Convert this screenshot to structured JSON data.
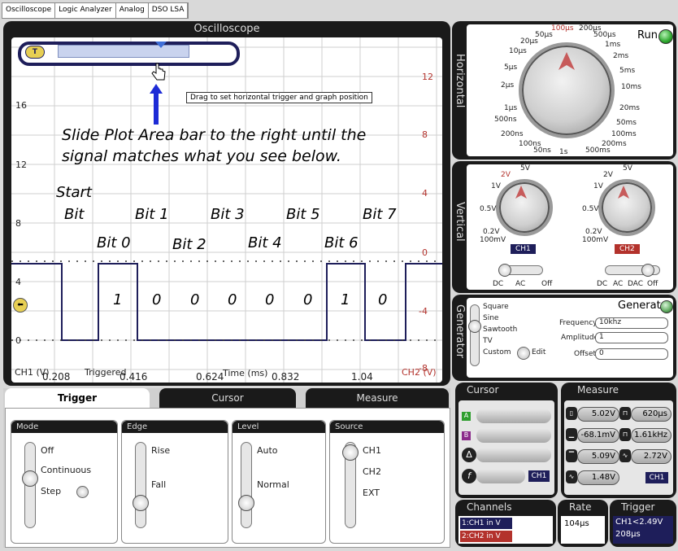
{
  "top_tabs": [
    "Oscilloscope",
    "Logic Analyzer",
    "Analog",
    "DSO LSA"
  ],
  "scope": {
    "title": "Oscilloscope",
    "tooltip": "Drag to set horizontal trigger and graph position",
    "trigger_handle_label": "T",
    "instruction_line1": "Slide Plot Area bar to the right until the",
    "instruction_line2": "signal matches what you see below.",
    "start_label_1": "Start",
    "start_label_2": "Bit",
    "bit_labels_top": [
      "Bit 1",
      "Bit 3",
      "Bit 5",
      "Bit 7"
    ],
    "bit_labels_bottom": [
      "Bit 0",
      "Bit 2",
      "Bit 4",
      "Bit 6"
    ],
    "bit_values": [
      "1",
      "0",
      "0",
      "0",
      "0",
      "0",
      "1",
      "0"
    ],
    "y_left_ticks": [
      "16",
      "12",
      "8",
      "4",
      "0"
    ],
    "y_right_ticks": [
      "12",
      "8",
      "4",
      "0",
      "-4",
      "-8"
    ],
    "x_ticks": [
      "0.208",
      "0.416",
      "0.624",
      "0.832",
      "1.04"
    ],
    "ch1_axis": "CH1 (V)",
    "ch2_axis": "CH2 (V)",
    "triggered": "Triggered",
    "time_axis": "Time (ms)"
  },
  "horizontal": {
    "side_label": "Horizontal",
    "run_label": "Run",
    "dial_labels": [
      "100µs",
      "200µs",
      "50µs",
      "500µs",
      "20µs",
      "1ms",
      "10µs",
      "2ms",
      "5µs",
      "5ms",
      "2µs",
      "10ms",
      "1µs",
      "20ms",
      "500ns",
      "50ms",
      "200ns",
      "100ms",
      "100ns",
      "200ms",
      "50ns",
      "500ms",
      "1s"
    ]
  },
  "vertical": {
    "side_label": "Vertical",
    "ch1_dial": [
      "5V",
      "2V",
      "1V",
      "0.5V",
      "0.2V",
      "100mV"
    ],
    "ch2_dial": [
      "5V",
      "2V",
      "1V",
      "0.5V",
      "0.2V",
      "100mV"
    ],
    "ch1_badge": "CH1",
    "ch2_badge": "CH2",
    "ch1_coupling": [
      "DC",
      "AC",
      "Off"
    ],
    "ch2_coupling": [
      "DC",
      "AC",
      "DAC",
      "Off"
    ]
  },
  "generator": {
    "side_label": "Generator",
    "generate_label": "Generate",
    "waveforms": [
      "Square",
      "Sine",
      "Sawtooth",
      "TV",
      "Custom"
    ],
    "edit_label": "Edit",
    "frequency_label": "Frequency",
    "frequency_value": "10khz",
    "amplitude_label": "Amplitude",
    "amplitude_value": "1",
    "offset_label": "Offset",
    "offset_value": "0"
  },
  "bottom_tabs": [
    "Trigger",
    "Cursor",
    "Measure"
  ],
  "trigger_panel": {
    "mode": {
      "title": "Mode",
      "options": [
        "Off",
        "Continuous",
        "Step"
      ]
    },
    "edge": {
      "title": "Edge",
      "options": [
        "Rise",
        "Fall"
      ]
    },
    "level": {
      "title": "Level",
      "options": [
        "Auto",
        "Normal"
      ]
    },
    "source": {
      "title": "Source",
      "options": [
        "CH1",
        "CH2",
        "EXT"
      ]
    }
  },
  "cursor_panel": {
    "title": "Cursor",
    "badges": [
      "A",
      "B",
      "Δ",
      "f"
    ],
    "channel": "CH1"
  },
  "measure_panel": {
    "title": "Measure",
    "values": [
      "5.02V",
      "620µs",
      "-68.1mV",
      "1.61kHz",
      "5.09V",
      "2.72V",
      "1.48V"
    ],
    "channel": "CH1"
  },
  "channels": {
    "title": "Channels",
    "items": [
      "1:CH1 in V",
      "2:CH2 in V"
    ]
  },
  "rate": {
    "title": "Rate",
    "value": "104µs"
  },
  "trigger_box": {
    "title": "Trigger",
    "line1": "CH1<2.49V",
    "line2": "208µs"
  },
  "colors": {
    "trace": "#1e1e5a",
    "accent_red": "#b3322c",
    "run_green": "#2ea82e",
    "panel_dark": "#1a1a1a"
  }
}
